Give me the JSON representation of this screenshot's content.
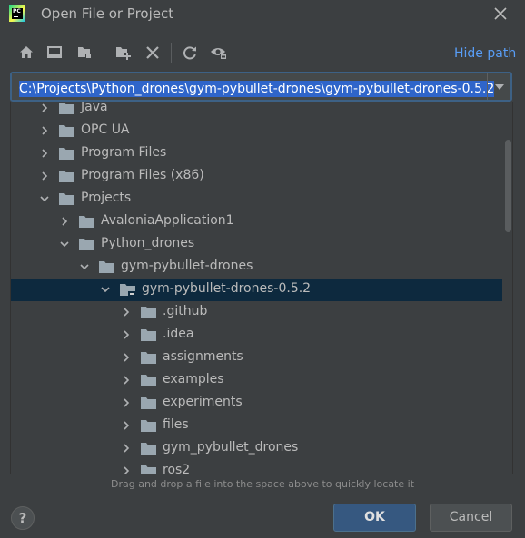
{
  "window": {
    "title": "Open File or Project",
    "logo_text": "PC"
  },
  "toolbar": {
    "hide_path_label": "Hide path",
    "buttons": [
      "home-icon",
      "desktop-icon",
      "project-folder-icon",
      "new-folder-icon",
      "delete-icon",
      "refresh-icon",
      "show-hidden-icon"
    ]
  },
  "path": {
    "value": "C:\\Projects\\Python_drones\\gym-pybullet-drones\\gym-pybullet-drones-0.5.2"
  },
  "tree": {
    "rows": [
      {
        "label": "Java",
        "expanded": false,
        "selected": false
      },
      {
        "label": "OPC UA",
        "expanded": false,
        "selected": false
      },
      {
        "label": "Program Files",
        "expanded": false,
        "selected": false
      },
      {
        "label": "Program Files (x86)",
        "expanded": false,
        "selected": false
      },
      {
        "label": "Projects",
        "expanded": true,
        "selected": false
      },
      {
        "label": "AvaloniaApplication1",
        "expanded": false,
        "selected": false
      },
      {
        "label": "Python_drones",
        "expanded": true,
        "selected": false
      },
      {
        "label": "gym-pybullet-drones",
        "expanded": true,
        "selected": false
      },
      {
        "label": "gym-pybullet-drones-0.5.2",
        "expanded": true,
        "selected": true
      },
      {
        "label": ".github",
        "expanded": false,
        "selected": false
      },
      {
        "label": ".idea",
        "expanded": false,
        "selected": false
      },
      {
        "label": "assignments",
        "expanded": false,
        "selected": false
      },
      {
        "label": "examples",
        "expanded": false,
        "selected": false
      },
      {
        "label": "experiments",
        "expanded": false,
        "selected": false
      },
      {
        "label": "files",
        "expanded": false,
        "selected": false
      },
      {
        "label": "gym_pybullet_drones",
        "expanded": false,
        "selected": false
      },
      {
        "label": "ros2",
        "expanded": false,
        "selected": false
      }
    ]
  },
  "hint": "Drag and drop a file into the space above to quickly locate it",
  "buttons": {
    "help": "?",
    "ok": "OK",
    "cancel": "Cancel"
  },
  "colors": {
    "background": "#3c3f41",
    "selection": "#0d293e",
    "path_highlight": "#2f65ca",
    "link": "#589df6",
    "ok_button": "#365880",
    "folder": "#9aa7b0"
  }
}
